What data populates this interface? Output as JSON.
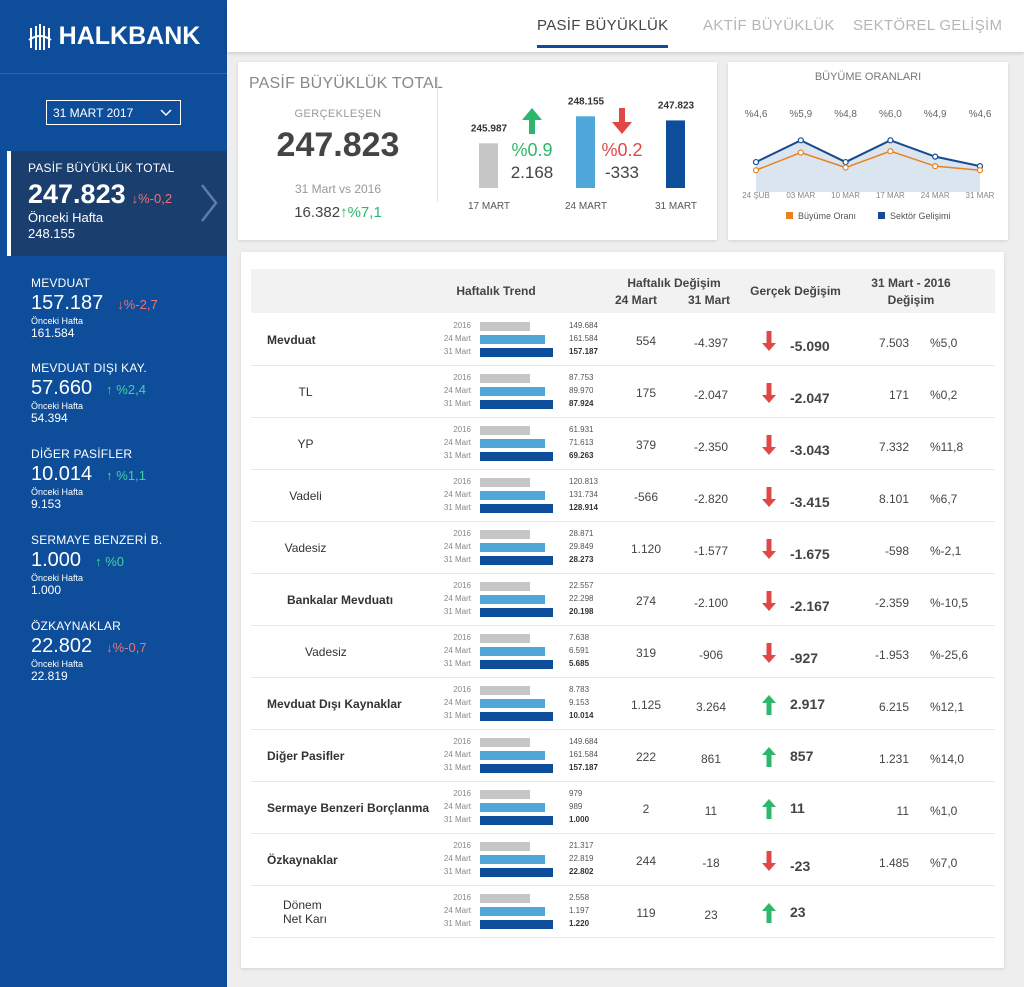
{
  "brand": {
    "name": "HALKBANK"
  },
  "sidebar": {
    "date": "31 MART 2017",
    "active": {
      "title": "PASİF BÜYÜKLÜK TOTAL",
      "value": "247.823",
      "change": "%-0,2",
      "prev_label": "Önceki Hafta",
      "prev": "248.155"
    },
    "items": [
      {
        "title": "MEVDUAT",
        "value": "157.187",
        "change": "%-2,7",
        "dir": "down",
        "prev_label": "Önceki Hafta",
        "prev": "161.584"
      },
      {
        "title": "MEVDUAT DIŞI KAY.",
        "value": "57.660",
        "change": "%2,4",
        "dir": "up",
        "prev_label": "Önceki Hafta",
        "prev": "54.394"
      },
      {
        "title": "DİĞER PASİFLER",
        "value": "10.014",
        "change": "%1,1",
        "dir": "up",
        "prev_label": "Önceki Hafta",
        "prev": "9.153"
      },
      {
        "title": "SERMAYE BENZERİ B.",
        "value": "1.000",
        "change": "%0",
        "dir": "up",
        "prev_label": "Önceki Hafta",
        "prev": "1.000"
      },
      {
        "title": "ÖZKAYNAKLAR",
        "value": "22.802",
        "change": "%-0,7",
        "dir": "down",
        "prev_label": "Önceki Hafta",
        "prev": "22.819"
      }
    ]
  },
  "nav": {
    "tabs": [
      "PASİF BÜYÜKLÜK",
      "AKTİF BÜYÜKLÜK",
      "SEKTÖREL GELİŞİM"
    ],
    "active": 0
  },
  "total": {
    "title": "PASİF BÜYÜKLÜK TOTAL",
    "sub": "GERÇEKLEŞEN",
    "value": "247.823",
    "compare": "31 Mart vs 2016",
    "diff": "16.382",
    "diff_pct": "%7,1"
  },
  "weekly": {
    "bars": [
      {
        "label": "17 MART",
        "value": 245.987,
        "text": "245.987"
      },
      {
        "label": "24 MART",
        "value": 248.155,
        "text": "248.155"
      },
      {
        "label": "31 MART",
        "value": 247.823,
        "text": "247.823"
      }
    ],
    "changes": [
      {
        "pct": "%0.9",
        "abs": "2.168",
        "dir": "up"
      },
      {
        "pct": "%0.2",
        "abs": "-333",
        "dir": "down"
      }
    ]
  },
  "chart_data": {
    "type": "line",
    "title": "BÜYÜME ORANLARI",
    "categories": [
      "24 ŞUB",
      "03 MAR",
      "10 MAR",
      "17 MAR",
      "24 MAR",
      "31 MAR"
    ],
    "top_labels": [
      "%4,6",
      "%5,9",
      "%4,8",
      "%6,0",
      "%4,9",
      "%4,6"
    ],
    "series": [
      {
        "name": "Büyüme Oranı",
        "values": [
          4.6,
          5.9,
          4.8,
          6.0,
          4.9,
          4.6
        ],
        "color": "#e8821e"
      },
      {
        "name": "Sektör Gelişimi",
        "values": [
          5.2,
          6.8,
          5.2,
          6.8,
          5.6,
          4.9
        ],
        "color": "#174a8f"
      }
    ],
    "ylim": [
      3,
      8
    ],
    "legend": "bottom"
  },
  "table": {
    "headers": {
      "trend": "Haftalık Trend",
      "weekly": "Haftalık Değişim",
      "w24": "24 Mart",
      "w31": "31 Mart",
      "real": "Gerçek Değişim",
      "ytd1": "31 Mart - 2016",
      "ytd2": "Değişim"
    },
    "trend_labels": [
      "2016",
      "24 Mart",
      "31 Mart"
    ],
    "trend_colors": [
      "#c6c6c6",
      "#4fa6d9",
      "#0d4d9a"
    ],
    "rows": [
      {
        "name": "Mevduat",
        "indent": 0,
        "bold": true,
        "trend": [
          "149.684",
          "161.584",
          "157.187"
        ],
        "w24": "554",
        "w31": "-4.397",
        "dir": "down",
        "real": "-5.090",
        "ytd": "7.503",
        "ytd_pct": "%5,0"
      },
      {
        "name": "TL",
        "indent": 1,
        "bold": false,
        "trend": [
          "87.753",
          "89.970",
          "87.924"
        ],
        "w24": "175",
        "w31": "-2.047",
        "dir": "down",
        "real": "-2.047",
        "ytd": "171",
        "ytd_pct": "%0,2"
      },
      {
        "name": "YP",
        "indent": 1,
        "bold": false,
        "trend": [
          "61.931",
          "71.613",
          "69.263"
        ],
        "w24": "379",
        "w31": "-2.350",
        "dir": "down",
        "real": "-3.043",
        "ytd": "7.332",
        "ytd_pct": "%11,8"
      },
      {
        "name": "Vadeli",
        "indent": 1,
        "bold": false,
        "trend": [
          "120.813",
          "131.734",
          "128.914"
        ],
        "w24": "-566",
        "w31": "-2.820",
        "dir": "down",
        "real": "-3.415",
        "ytd": "8.101",
        "ytd_pct": "%6,7"
      },
      {
        "name": "Vadesiz",
        "indent": 1,
        "bold": false,
        "trend": [
          "28.871",
          "29.849",
          "28.273"
        ],
        "w24": "1.120",
        "w31": "-1.577",
        "dir": "down",
        "real": "-1.675",
        "ytd": "-598",
        "ytd_pct": "%-2,1"
      },
      {
        "name": "Bankalar Mevduatı",
        "indent": 1,
        "bold": true,
        "trend": [
          "22.557",
          "22.298",
          "20.198"
        ],
        "w24": "274",
        "w31": "-2.100",
        "dir": "down",
        "real": "-2.167",
        "ytd": "-2.359",
        "ytd_pct": "%-10,5"
      },
      {
        "name": "Vadesiz",
        "indent": 2,
        "bold": false,
        "trend": [
          "7.638",
          "6.591",
          "5.685"
        ],
        "w24": "319",
        "w31": "-906",
        "dir": "down",
        "real": "-927",
        "ytd": "-1.953",
        "ytd_pct": "%-25,6"
      },
      {
        "name": "Mevduat Dışı Kaynaklar",
        "indent": 0,
        "bold": true,
        "trend": [
          "8.783",
          "9.153",
          "10.014"
        ],
        "w24": "1.125",
        "w31": "3.264",
        "dir": "up",
        "real": "2.917",
        "ytd": "6.215",
        "ytd_pct": "%12,1"
      },
      {
        "name": "Diğer Pasifler",
        "indent": 0,
        "bold": true,
        "trend": [
          "149.684",
          "161.584",
          "157.187"
        ],
        "w24": "222",
        "w31": "861",
        "dir": "up",
        "real": "857",
        "ytd": "1.231",
        "ytd_pct": "%14,0"
      },
      {
        "name": "Sermaye Benzeri Borçlanma",
        "indent": 0,
        "bold": true,
        "trend": [
          "979",
          "989",
          "1.000"
        ],
        "w24": "2",
        "w31": "11",
        "dir": "up",
        "real": "11",
        "ytd": "11",
        "ytd_pct": "%1,0"
      },
      {
        "name": "Özkaynaklar",
        "indent": 0,
        "bold": true,
        "trend": [
          "21.317",
          "22.819",
          "22.802"
        ],
        "w24": "244",
        "w31": "-18",
        "dir": "down",
        "real": "-23",
        "ytd": "1.485",
        "ytd_pct": "%7,0"
      },
      {
        "name": "Dönem Net Karı",
        "indent": 1,
        "bold": false,
        "trend": [
          "2.558",
          "1.197",
          "1.220"
        ],
        "w24": "119",
        "w31": "23",
        "dir": "up",
        "real": "23",
        "ytd": "",
        "ytd_pct": ""
      }
    ]
  }
}
